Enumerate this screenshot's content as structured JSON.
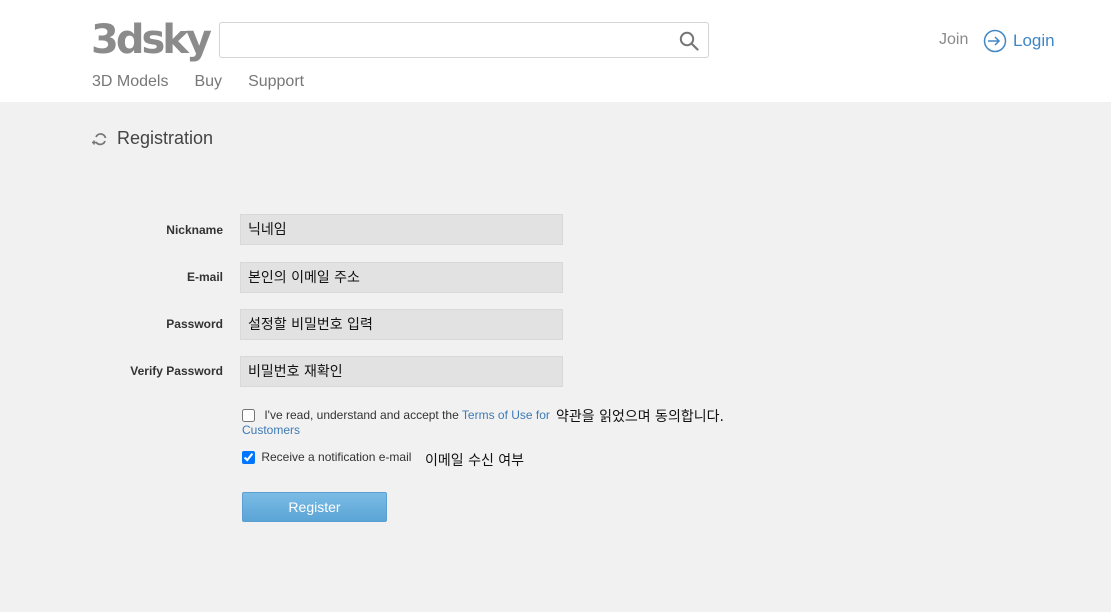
{
  "brand": {
    "logo_text": "3dsky"
  },
  "search": {
    "value": "",
    "placeholder": ""
  },
  "header": {
    "join_label": "Join",
    "login_label": "Login"
  },
  "nav": {
    "items": [
      {
        "label": "3D Models"
      },
      {
        "label": "Buy"
      },
      {
        "label": "Support"
      }
    ]
  },
  "page": {
    "title": "Registration"
  },
  "form": {
    "nickname": {
      "label": "Nickname",
      "placeholder": "닉네임"
    },
    "email": {
      "label": "E-mail",
      "placeholder": "본인의 이메일 주소"
    },
    "password": {
      "label": "Password",
      "placeholder": "설정할 비밀번호 입력"
    },
    "verify": {
      "label": "Verify Password",
      "placeholder": "비밀번호 재확인"
    },
    "terms": {
      "checked": false,
      "text": "I've read, understand and accept the",
      "link_part1": "Terms of Use for",
      "link_part2": "Customers",
      "note": "약관을 읽었으며 동의합니다."
    },
    "notify": {
      "checked": true,
      "text": "Receive a notification e-mail",
      "note": "이메일 수신 여부"
    },
    "register_label": "Register"
  },
  "colors": {
    "accent": "#3f86c5",
    "button": "#6cb0de",
    "background": "#f1f1f1",
    "input_bg": "#e2e2e2"
  }
}
